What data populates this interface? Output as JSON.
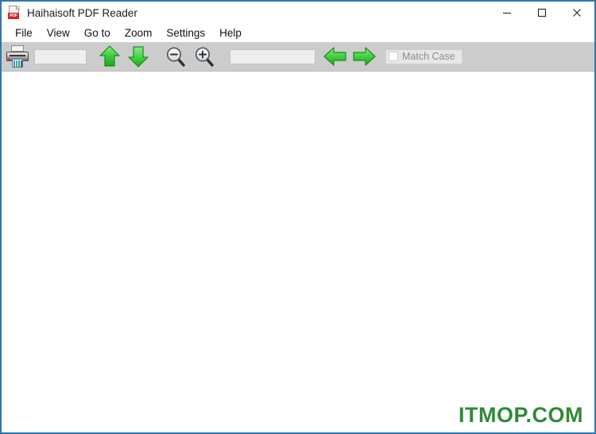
{
  "window": {
    "title": "Haihaisoft PDF Reader",
    "icon": "pdf-document-icon",
    "border_color": "#2a7ab0",
    "controls": {
      "minimize_label": "—",
      "maximize_label": "□",
      "close_label": "✕"
    }
  },
  "menu": {
    "items": [
      {
        "label": "File"
      },
      {
        "label": "View"
      },
      {
        "label": "Go to"
      },
      {
        "label": "Zoom"
      },
      {
        "label": "Settings"
      },
      {
        "label": "Help"
      }
    ]
  },
  "toolbar": {
    "background_color": "#cccccc",
    "print_button": {
      "icon": "printer-icon",
      "tooltip": "Print"
    },
    "page_input": {
      "value": "",
      "placeholder": ""
    },
    "previous_page_button": {
      "icon": "arrow-up-icon",
      "color": "#3cc73c"
    },
    "next_page_button": {
      "icon": "arrow-down-icon",
      "color": "#3cc73c"
    },
    "zoom_out_button": {
      "icon": "magnifier-minus-icon"
    },
    "zoom_in_button": {
      "icon": "magnifier-plus-icon"
    },
    "search_input": {
      "value": "",
      "placeholder": ""
    },
    "find_previous_button": {
      "icon": "arrow-left-icon",
      "color": "#3cc73c"
    },
    "find_next_button": {
      "icon": "arrow-right-icon",
      "color": "#3cc73c"
    },
    "match_case": {
      "label": "Match Case",
      "checked": false,
      "enabled": false
    }
  },
  "document": {
    "content": "",
    "background_color": "#ffffff",
    "watermark": {
      "text": "ITMOP.COM",
      "color": "#2f8a36"
    }
  }
}
